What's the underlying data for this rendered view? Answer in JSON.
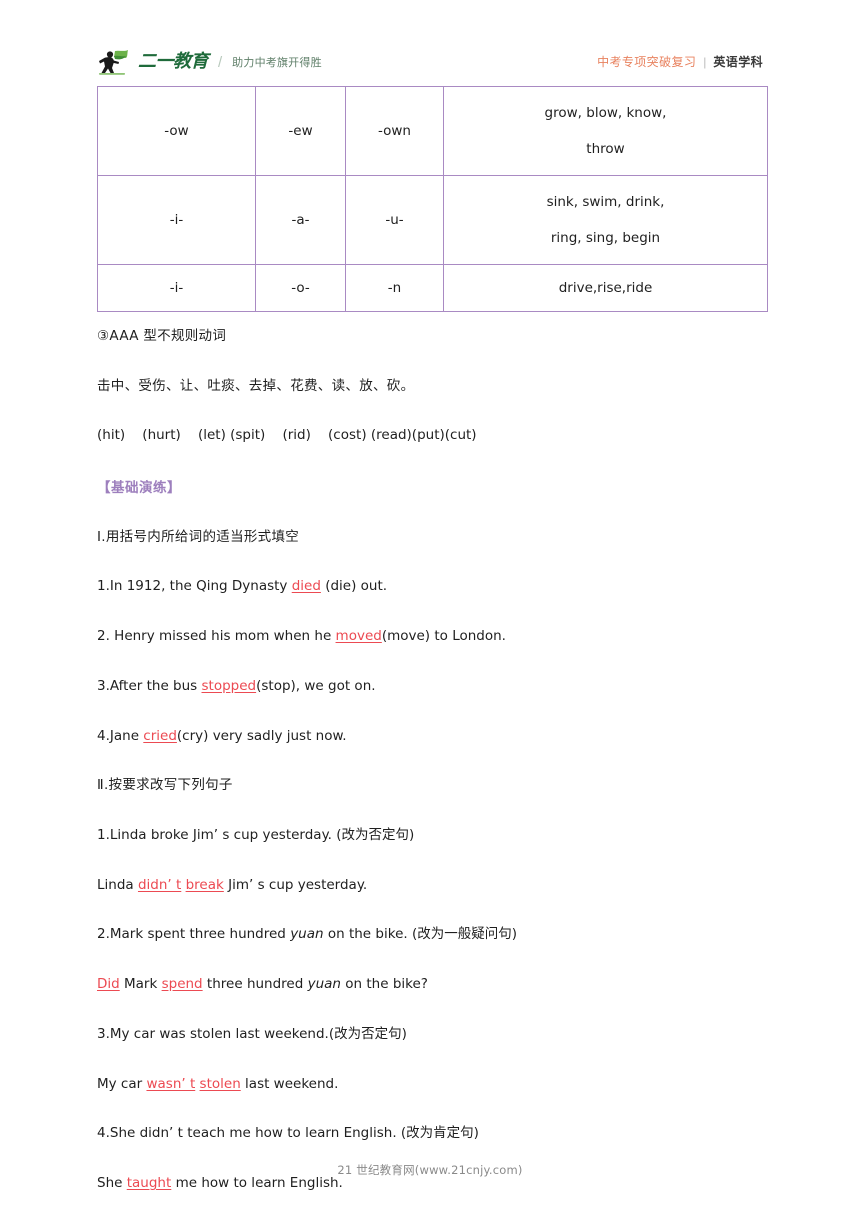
{
  "header": {
    "brand_name": "二一教育",
    "brand_divider": "/",
    "brand_slogan": "助力中考旗开得胜",
    "right_primary": "中考专项突破复习",
    "right_separator": "|",
    "right_secondary": "英语学科",
    "logo_icon": "running-man-flag-icon",
    "brand_color": "#1f6b3b",
    "accent_color": "#e8825f"
  },
  "table": {
    "border_color": "#a98ac3",
    "rows": [
      {
        "col1": "-ow",
        "col2": "-ew",
        "col3": "-own",
        "col4_lines": [
          "grow, blow, know,",
          "throw"
        ]
      },
      {
        "col1": "-i-",
        "col2": "-a-",
        "col3": "-u-",
        "col4_lines": [
          "sink, swim, drink,",
          "ring, sing, begin"
        ]
      },
      {
        "col1": "-i-",
        "col2": "-o-",
        "col3": "-n",
        "col4_lines": [
          "drive,rise,ride"
        ]
      }
    ]
  },
  "body": {
    "heading_aaa": "③AAA 型不规则动词",
    "cn_verbs": "击中、受伤、让、吐痰、去掉、花费、读、放、砍。",
    "en_verbs": "(hit)    (hurt)    (let) (spit)    (rid)    (cost) (read)(put)(cut)",
    "exercise_title": "【基础演练】",
    "exercise_title_color": "#9d7fbd",
    "answer_color": "#ec4a52",
    "section1_heading": "Ⅰ.用括号内所给词的适当形式填空",
    "section1": [
      {
        "pre": "1.In 1912, the Qing Dynasty ",
        "answer": "died",
        "post": " (die) out."
      },
      {
        "pre": "2. Henry missed his mom when he ",
        "answer": "moved",
        "post": "(move) to London."
      },
      {
        "pre": "3.After the bus ",
        "answer": "stopped",
        "post": "(stop), we got on."
      },
      {
        "pre": "4.Jane ",
        "answer": "cried",
        "post": "(cry) very sadly just now."
      }
    ],
    "section2_heading": "Ⅱ.按要求改写下列句子",
    "section2": [
      {
        "question": "1.Linda broke Jim’ s cup yesterday. (改为否定句)",
        "answer_pre": "Linda ",
        "answer_parts": [
          "didn’ t",
          "break"
        ],
        "answer_post": " Jim’ s cup yesterday."
      },
      {
        "question_pre": "2.Mark spent three hundred ",
        "question_italic": "yuan",
        "question_post": " on the bike. (改为一般疑问句)",
        "answer_a": "Did",
        "answer_mid": " Mark ",
        "answer_b": "spend",
        "answer_tail_pre": " three hundred ",
        "answer_tail_italic": "yuan",
        "answer_tail_post": " on the bike?"
      },
      {
        "question": "3.My car was stolen last weekend.(改为否定句)",
        "answer_pre": "My car ",
        "answer_parts": [
          "wasn’ t",
          "stolen"
        ],
        "answer_post": " last weekend."
      },
      {
        "question": "4.She didn’ t teach me how to learn English. (改为肯定句)",
        "answer_pre": "She ",
        "answer_parts": [
          "taught"
        ],
        "answer_post": " me how to learn English."
      }
    ]
  },
  "footer": {
    "text": "21 世纪教育网(www.21cnjy.com)"
  }
}
